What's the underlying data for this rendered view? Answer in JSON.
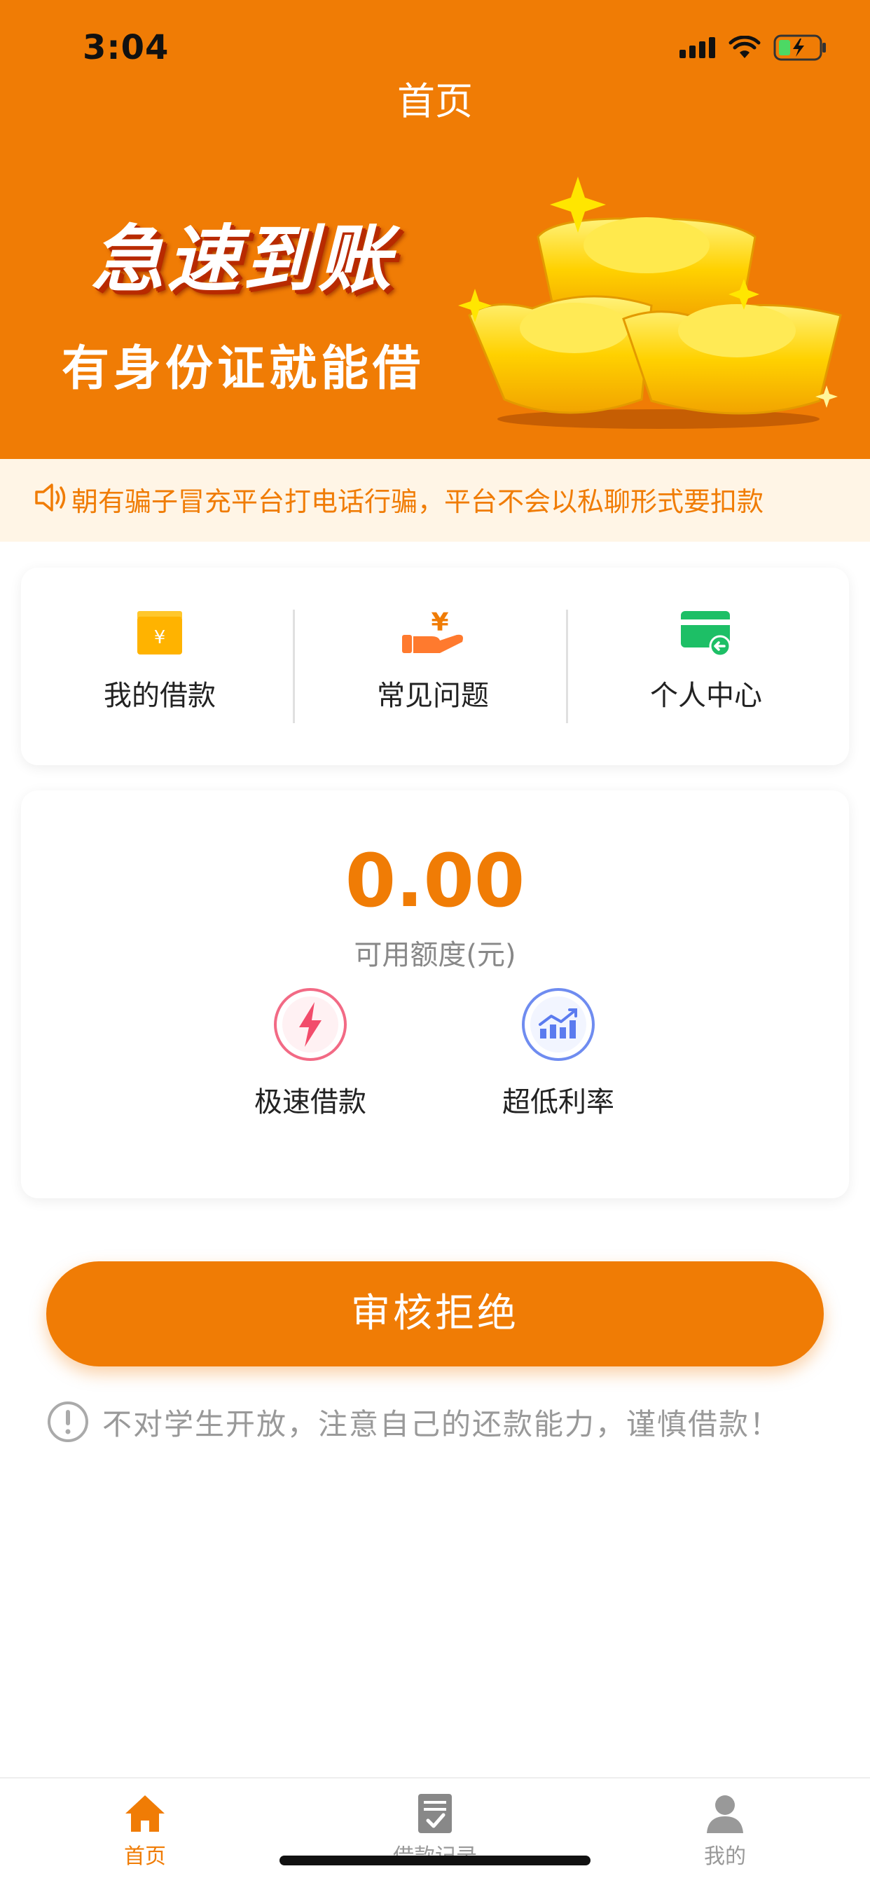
{
  "status_bar": {
    "time": "3:04"
  },
  "header": {
    "title": "首页"
  },
  "banner": {
    "title": "急速到账",
    "subtitle": "有身份证就能借"
  },
  "notice": {
    "text": "朝有骗子冒充平台打电话行骗，平台不会以私聊形式要扣款"
  },
  "menu": [
    {
      "label": "我的借款",
      "icon": "wallet-yen-icon"
    },
    {
      "label": "常见问题",
      "icon": "hand-yen-icon"
    },
    {
      "label": "个人中心",
      "icon": "card-arrow-icon"
    }
  ],
  "credit": {
    "amount": "0.00",
    "label": "可用额度(元)",
    "features": [
      {
        "label": "极速借款",
        "icon": "lightning-icon"
      },
      {
        "label": "超低利率",
        "icon": "chart-trend-icon"
      }
    ]
  },
  "action": {
    "button_label": "审核拒绝"
  },
  "warning": {
    "text": "不对学生开放，注意自己的还款能力，谨慎借款！"
  },
  "tab_bar": {
    "items": [
      {
        "label": "首页",
        "icon": "home-icon",
        "active": true
      },
      {
        "label": "借款记录",
        "icon": "document-check-icon",
        "active": false
      },
      {
        "label": "我的",
        "icon": "user-icon",
        "active": false
      }
    ]
  },
  "colors": {
    "brand": "#F07C05",
    "notice_bg": "#FFF5E6",
    "gold": "#FFD100",
    "inactive": "#999999"
  }
}
